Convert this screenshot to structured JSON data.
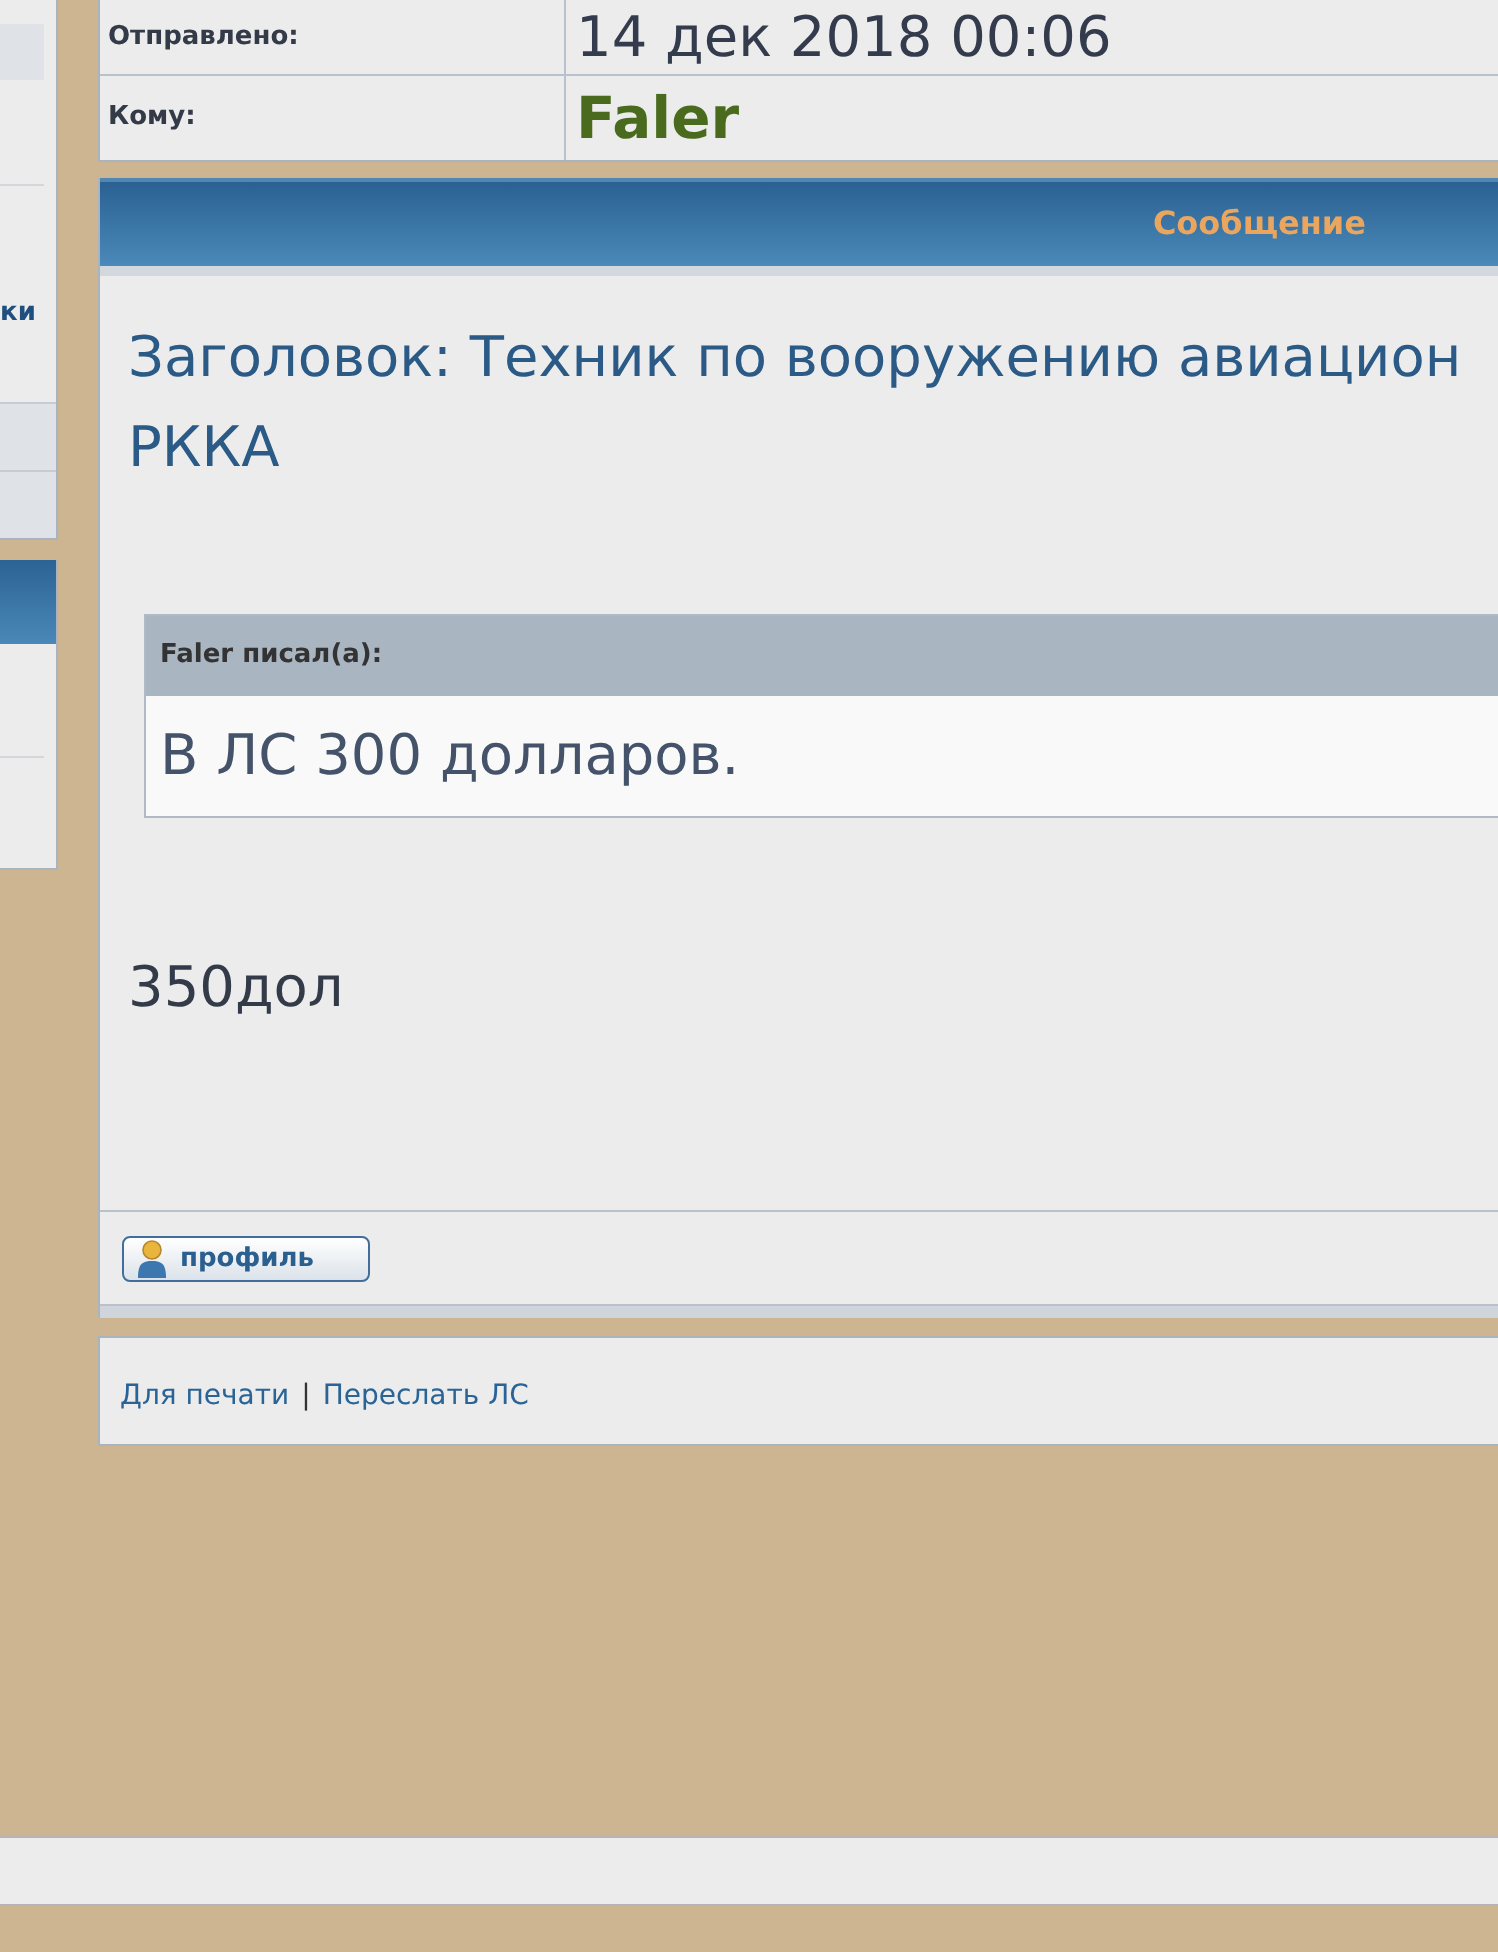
{
  "sidebar": {
    "link_fragment": "ки"
  },
  "details": [
    {
      "kind": "date",
      "label": "Отправлено:",
      "value": "14 дек 2018 00:06"
    },
    {
      "kind": "user",
      "label": "Кому:",
      "value": "Faler"
    }
  ],
  "message": {
    "header": "Сообщение",
    "title_lines": [
      "Заголовок: Техник по вооружению авиацион",
      "РККА"
    ],
    "quote": {
      "author": "Faler писал(а):",
      "text": "В ЛС 300 долларов."
    },
    "body": "350дол",
    "profile_button": "профиль"
  },
  "footer": {
    "links": [
      "Для печати",
      "Переслать ЛС"
    ],
    "separator": "|"
  }
}
